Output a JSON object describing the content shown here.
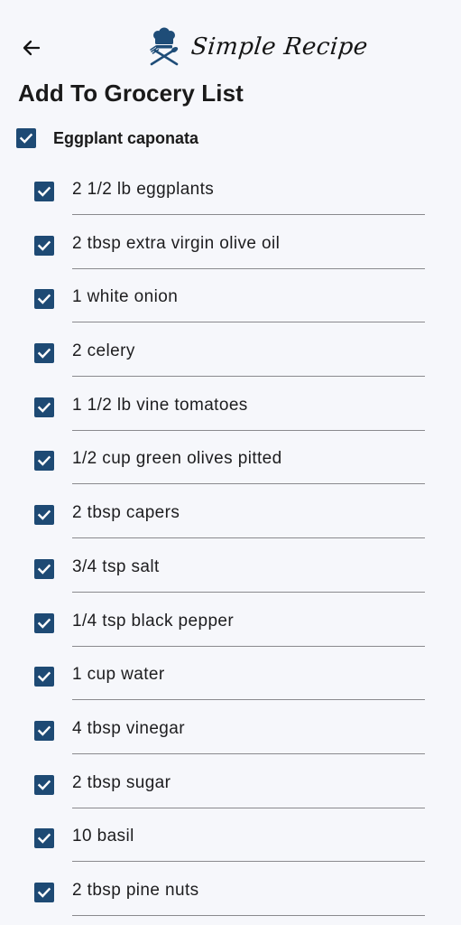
{
  "header": {
    "back_icon": "arrow-left-icon",
    "logo_icon": "chef-hat-crossed-utensils-icon",
    "brand_name": "Simple Recipe"
  },
  "page": {
    "title": "Add To Grocery List"
  },
  "recipe": {
    "name": "Eggplant caponata",
    "checked": true
  },
  "ingredients": [
    {
      "label": "2 1/2 lb eggplants",
      "checked": true
    },
    {
      "label": "2 tbsp extra virgin olive oil",
      "checked": true
    },
    {
      "label": "1 white onion",
      "checked": true
    },
    {
      "label": "2 celery",
      "checked": true
    },
    {
      "label": "1 1/2 lb vine tomatoes",
      "checked": true
    },
    {
      "label": "1/2 cup green olives pitted",
      "checked": true
    },
    {
      "label": "2 tbsp capers",
      "checked": true
    },
    {
      "label": "3/4 tsp salt",
      "checked": true
    },
    {
      "label": "1/4 tsp black pepper",
      "checked": true
    },
    {
      "label": "1 cup water",
      "checked": true
    },
    {
      "label": "4 tbsp vinegar",
      "checked": true
    },
    {
      "label": "2 tbsp sugar",
      "checked": true
    },
    {
      "label": "10 basil",
      "checked": true
    },
    {
      "label": "2 tbsp pine nuts",
      "checked": true
    }
  ],
  "colors": {
    "background": "#f6f7fb",
    "checkbox_fill": "#1e4a74",
    "brand_mark": "#1f4d78",
    "underline": "#8a8a8e"
  }
}
